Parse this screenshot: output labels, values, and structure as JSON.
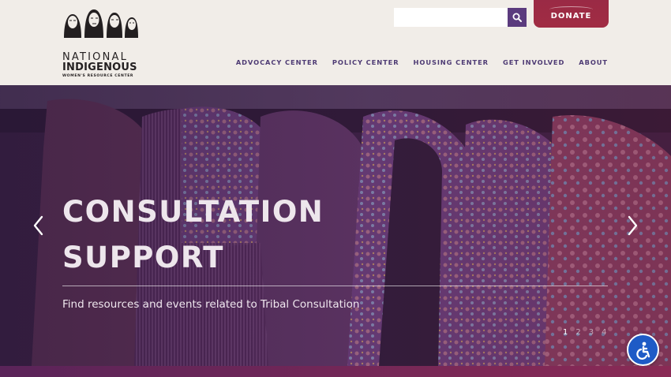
{
  "header": {
    "logo": {
      "line1": "NATIONAL",
      "line2": "INDIGENOUS",
      "line3": "WOMEN'S RESOURCE CENTER"
    },
    "search": {
      "placeholder": "",
      "icon": "search-icon"
    },
    "donate_label": "DONATE",
    "nav": [
      {
        "label": "ADVOCACY CENTER"
      },
      {
        "label": "POLICY CENTER"
      },
      {
        "label": "HOUSING CENTER"
      },
      {
        "label": "GET INVOLVED"
      },
      {
        "label": "ABOUT"
      }
    ]
  },
  "hero": {
    "title_line1": "CONSULTATION",
    "title_line2": "SUPPORT",
    "subtitle": "Find resources and events related to Tribal Consultation",
    "slides": [
      "1",
      "2",
      "3",
      "4"
    ],
    "active_slide": "1"
  },
  "colors": {
    "header_bg": "#f1ede8",
    "nav_text": "#4e3b74",
    "search_button": "#5b3b7e",
    "donate": "#a12c43",
    "accessibility": "#1e5bc6"
  }
}
